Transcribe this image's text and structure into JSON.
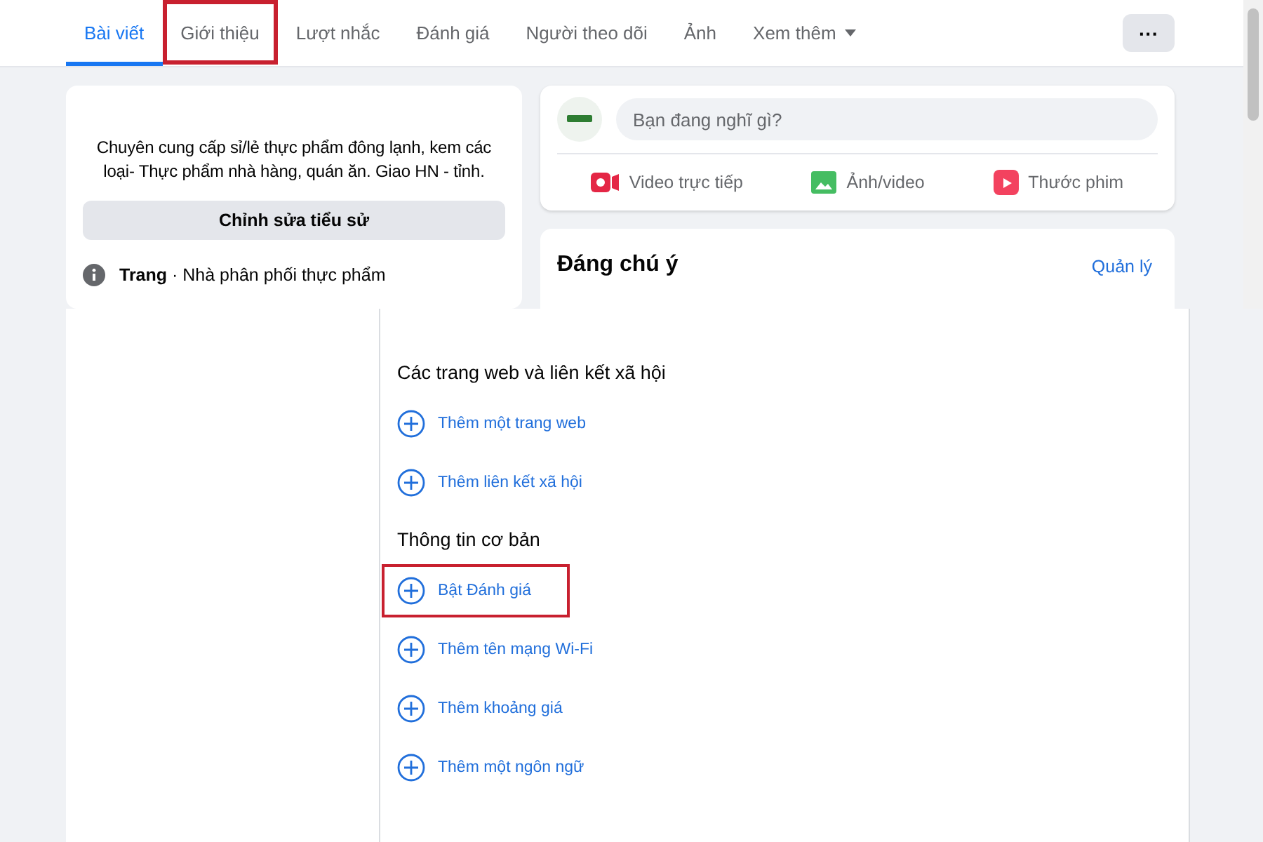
{
  "tabs": [
    {
      "label": "Bài viết",
      "selected": true,
      "highlighted": false
    },
    {
      "label": "Giới thiệu",
      "selected": false,
      "highlighted": true
    },
    {
      "label": "Lượt nhắc",
      "selected": false,
      "highlighted": false
    },
    {
      "label": "Đánh giá",
      "selected": false,
      "highlighted": false
    },
    {
      "label": "Người theo dõi",
      "selected": false,
      "highlighted": false
    },
    {
      "label": "Ảnh",
      "selected": false,
      "highlighted": false
    },
    {
      "label": "Xem thêm",
      "selected": false,
      "highlighted": false,
      "kind": "dropdown"
    }
  ],
  "more_button": "···",
  "intro": {
    "bio": "Chuyên cung cấp sỉ/lẻ thực phẩm đông lạnh, kem các loại- Thực phẩm nhà hàng, quán ăn. Giao HN - tỉnh.",
    "edit_button": "Chỉnh sửa tiểu sử",
    "category": "**Trang** · Nhà phân phối thực phẩm"
  },
  "composer": {
    "placeholder": "Bạn đang nghĩ gì?",
    "actions": [
      {
        "kind": "live",
        "label": "Video trực tiếp"
      },
      {
        "kind": "photo",
        "label": "Ảnh/video"
      },
      {
        "kind": "reel",
        "label": "Thước phim"
      }
    ]
  },
  "highlights": {
    "title": "Đáng chú ý",
    "link": "Quản lý"
  },
  "sections": [
    {
      "title": "Các trang web và liên kết xã hội",
      "items": [
        {
          "label": "Thêm một trang web",
          "highlighted": false
        },
        {
          "label": "Thêm liên kết xã hội",
          "highlighted": false
        }
      ]
    },
    {
      "title": "Thông tin cơ bản",
      "items": [
        {
          "label": "Bật Đánh giá",
          "highlighted": true
        },
        {
          "label": "Thêm tên mạng Wi-Fi",
          "highlighted": false
        },
        {
          "label": "Thêm khoảng giá",
          "highlighted": false
        },
        {
          "label": "Thêm một ngôn ngữ",
          "highlighted": false
        }
      ]
    }
  ]
}
